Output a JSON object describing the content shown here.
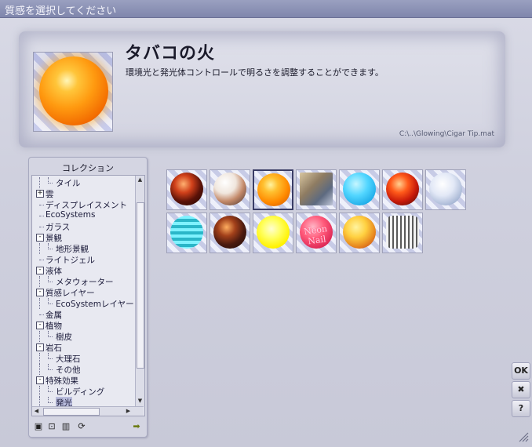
{
  "window": {
    "title": "質感を選択してください"
  },
  "material": {
    "title": "タバコの火",
    "description": "環境光と発光体コントロールで明るさを調整することができます。",
    "path": "C:\\..\\Glowing\\Cigar Tip.mat"
  },
  "collection": {
    "title": "コレクション",
    "tree": [
      {
        "label": "タイル",
        "depth": 1,
        "expander": ""
      },
      {
        "label": "雲",
        "depth": 0,
        "expander": "+"
      },
      {
        "label": "ディスプレイスメント",
        "depth": 0,
        "expander": ""
      },
      {
        "label": "EcoSystems",
        "depth": 0,
        "expander": ""
      },
      {
        "label": "ガラス",
        "depth": 0,
        "expander": ""
      },
      {
        "label": "景観",
        "depth": 0,
        "expander": "-"
      },
      {
        "label": "地形景観",
        "depth": 1,
        "expander": ""
      },
      {
        "label": "ライトジェル",
        "depth": 0,
        "expander": ""
      },
      {
        "label": "液体",
        "depth": 0,
        "expander": "-"
      },
      {
        "label": "メタウォーター",
        "depth": 1,
        "expander": ""
      },
      {
        "label": "質感レイヤー",
        "depth": 0,
        "expander": "-"
      },
      {
        "label": "EcoSystemレイヤー",
        "depth": 1,
        "expander": ""
      },
      {
        "label": "金属",
        "depth": 0,
        "expander": ""
      },
      {
        "label": "植物",
        "depth": 0,
        "expander": "-"
      },
      {
        "label": "樹皮",
        "depth": 1,
        "expander": ""
      },
      {
        "label": "岩石",
        "depth": 0,
        "expander": "-"
      },
      {
        "label": "大理石",
        "depth": 1,
        "expander": ""
      },
      {
        "label": "その他",
        "depth": 1,
        "expander": ""
      },
      {
        "label": "特殊効果",
        "depth": 0,
        "expander": "-"
      },
      {
        "label": "ビルディング",
        "depth": 1,
        "expander": ""
      },
      {
        "label": "発光",
        "depth": 1,
        "expander": "",
        "selected": true
      }
    ],
    "toolbar": [
      "new-icon",
      "lock-icon",
      "trash-icon",
      "refresh-icon",
      "arrow-right-icon"
    ]
  },
  "thumbnails": [
    {
      "name": "lava-sphere"
    },
    {
      "name": "marble-sphere"
    },
    {
      "name": "cigar-tip-sphere",
      "selected": true
    },
    {
      "name": "glass-cube"
    },
    {
      "name": "cyan-glow-sphere"
    },
    {
      "name": "red-lava-sphere"
    },
    {
      "name": "white-cloud-sphere"
    },
    {
      "name": "cyan-stripe-sphere"
    },
    {
      "name": "dark-lava-sphere"
    },
    {
      "name": "yellow-glow-sphere"
    },
    {
      "name": "neon-sphere",
      "text": "Neon Nail"
    },
    {
      "name": "yellow-red-sphere"
    },
    {
      "name": "building-cylinder"
    }
  ],
  "side_buttons": {
    "ok": "OK",
    "cancel": "✖",
    "help": "?"
  }
}
